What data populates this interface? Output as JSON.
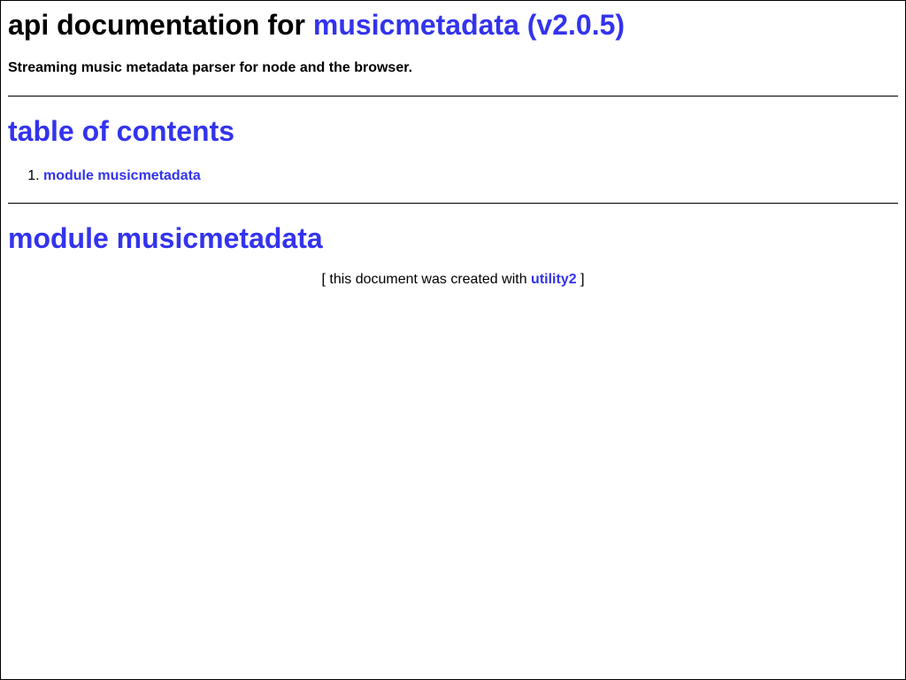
{
  "header": {
    "prefix": "api documentation for",
    "package_link": "musicmetadata (v2.0.5)"
  },
  "description": "Streaming music metadata parser for node and the browser.",
  "toc": {
    "title": "table of contents",
    "items": [
      {
        "label": "module musicmetadata"
      }
    ]
  },
  "module": {
    "title": "module musicmetadata"
  },
  "footer": {
    "prefix": "[ this document was created with",
    "link": "utility2",
    "suffix": "]"
  },
  "colors": {
    "link": "#3333ee",
    "text": "#000000",
    "background": "#ffffff"
  }
}
